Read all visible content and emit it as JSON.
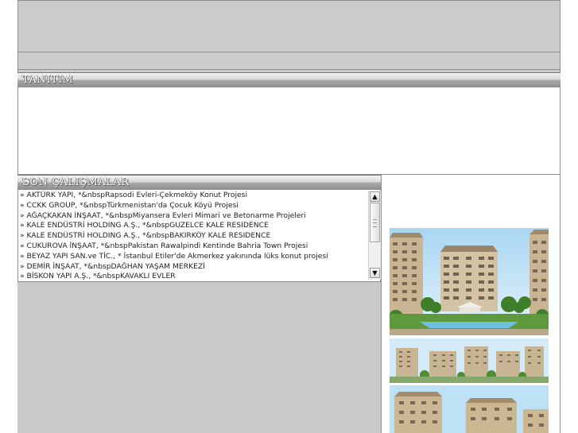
{
  "sections": {
    "tanitim_title": "TANITIM",
    "son_calismalar_title": "SON ÇALIŞMALAR"
  },
  "projects": [
    "» AKTÜRK YAPI, *&nbspRapsodi Evleri-Çekmeköy Konut Projesi",
    "» CCKK GROUP, *&nbspTürkmenistan'da Çocuk Köyü Projesi",
    "» AĞAÇKAKAN İNŞAAT, *&nbspMiyansera Evleri Mimari ve Betonarme Projeleri",
    "» KALE ENDÜSTRİ HOLDING A.Ş., *&nbspGUZELCE KALE RESIDENCE",
    "» KALE ENDÜSTRİ HOLDING A.Ş., *&nbspBAKIRKÖY KALE RESIDENCE",
    "» CUKUROVA İNŞAAT, *&nbspPakistan Rawalpindi Kentinde Bahria Town Projesi",
    "» BEYAZ YAPI SAN.ve TİC., * İstanbul Etiler'de Akmerkez yakınında lüks konut projesi",
    "» DEMİR İNŞAAT, *&nbspDAĞHAN YAŞAM MERKEZİ",
    "» BİSKON YAPI A.Ş., *&nbspKAVAKLI EVLER"
  ],
  "scrollbar": {
    "up_glyph": "▲",
    "down_glyph": "▼"
  },
  "colors": {
    "frame_gray": "#c9c9c9",
    "header_gradient_dark": "#8d8d8d",
    "sky_blue": "#bfe1f5",
    "building_beige": "#c8b99a",
    "grass_green": "#5f9b3c"
  }
}
